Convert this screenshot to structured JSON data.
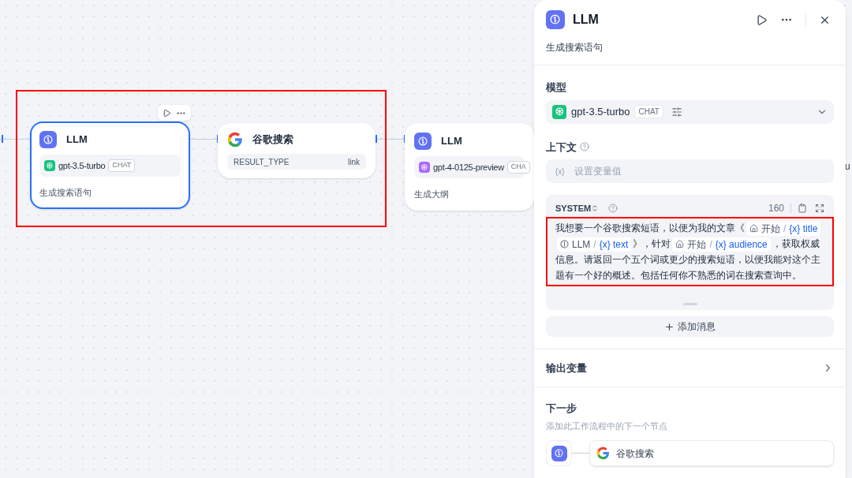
{
  "canvas": {
    "nodes": [
      {
        "kind": "llm",
        "title": "LLM",
        "model": "gpt-3.5-turbo",
        "color": "#19c37d",
        "mode": "CHAT",
        "description": "生成搜索语句",
        "selected": true
      },
      {
        "kind": "google",
        "title": "谷歌搜索",
        "param": "RESULT_TYPE",
        "param_value": "link",
        "selected": false
      },
      {
        "kind": "llm",
        "title": "LLM",
        "model": "gpt-4-0125-preview",
        "color": "#ab68ff",
        "mode": "CHA",
        "description": "生成大纲",
        "selected": false
      }
    ],
    "edge_text": "u"
  },
  "panel": {
    "title": "LLM",
    "description": "生成搜索语句",
    "model_label": "模型",
    "model": {
      "name": "gpt-3.5-turbo",
      "mode": "CHAT"
    },
    "context_label": "上下文",
    "context_mark": "{x}",
    "context_placeholder": "设置变量值",
    "prompt": {
      "role": "SYSTEM",
      "count": "160",
      "segments": [
        {
          "kind": "text",
          "text": "我想要一个谷歌搜索短语，以便为我的文章《"
        },
        {
          "kind": "start_var",
          "node": "开始",
          "separator": "/",
          "mark": "{x}",
          "name": "title"
        },
        {
          "kind": "llm_var",
          "node": "LLM",
          "separator": "/",
          "mark": "{x}",
          "name": "text"
        },
        {
          "kind": "text",
          "text": "》，针对"
        },
        {
          "kind": "start_var",
          "node": "开始",
          "separator": "/",
          "mark": "{x}",
          "name": "audience"
        },
        {
          "kind": "text",
          "text": "，获取权威信息。请返回一个五个词或更少的搜索短语，以便我能对这个主题有一个好的概述。包括任何你不熟悉的词在搜索查询中。"
        }
      ]
    },
    "add_message": "添加消息",
    "output_label": "输出变量",
    "next_label": "下一步",
    "next_hint": "添加此工作流程中的下一个节点",
    "next_node": "谷歌搜索"
  }
}
